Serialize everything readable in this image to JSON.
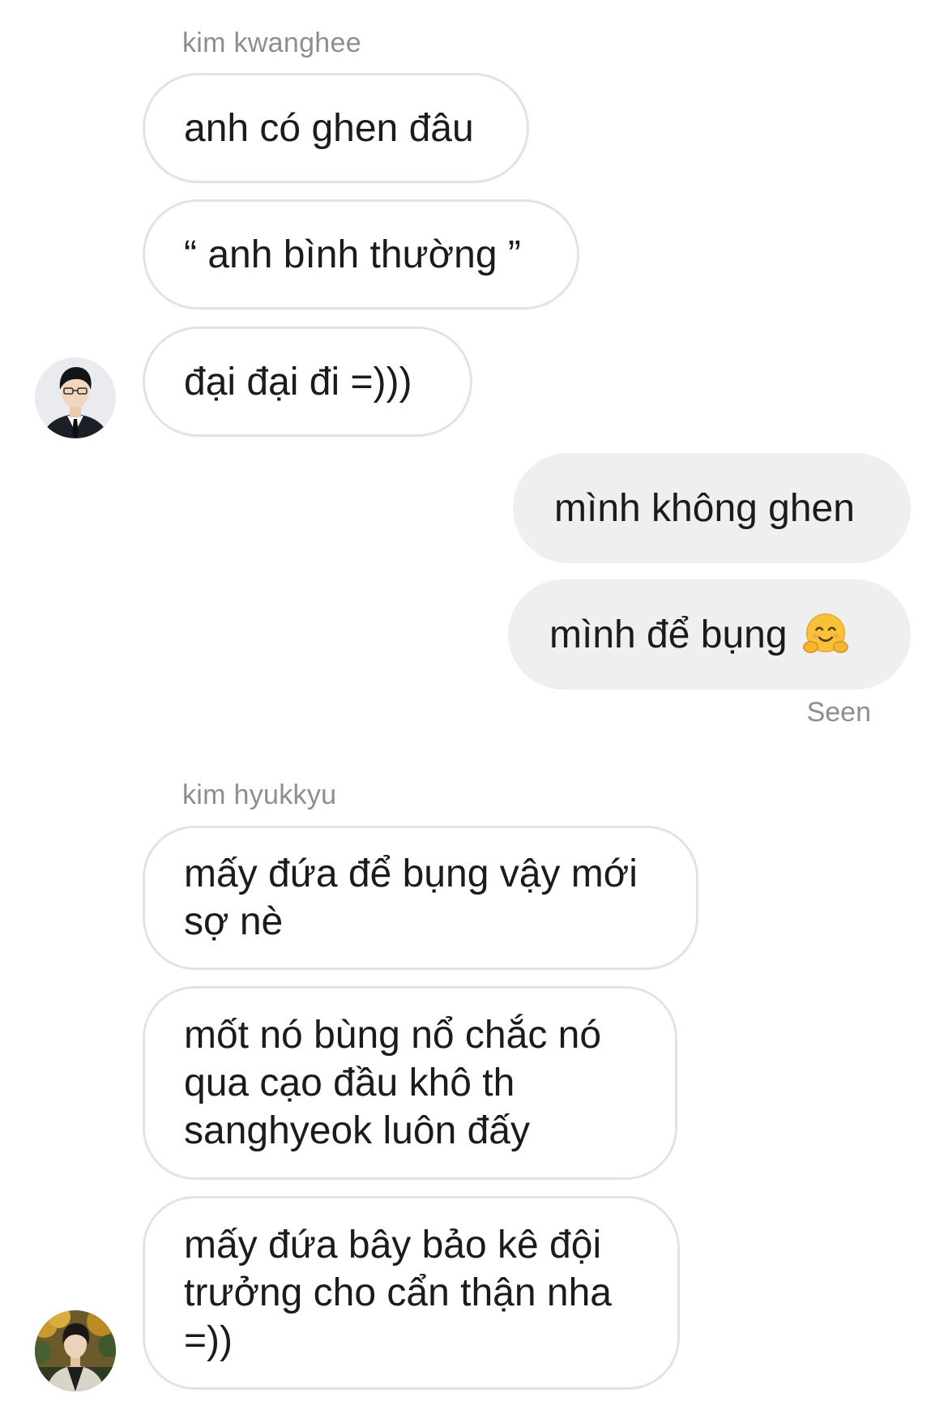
{
  "conversation": {
    "group1": {
      "sender": "kim kwanghee",
      "messages": [
        "anh có ghen đâu",
        "“ anh bình thường ”",
        "đại đại đi =)))"
      ],
      "avatar_icon": "profile-photo-suit-glasses"
    },
    "outgoing": {
      "messages": [
        "mình không ghen",
        "mình để bụng"
      ],
      "emoji_icon": "hugging-face-emoji",
      "status": "Seen"
    },
    "group2": {
      "sender": "kim hyukkyu",
      "messages": [
        "mấy đứa để bụng vậy mới sợ nè",
        "mốt nó bùng nổ chắc nó qua cạo đầu khô th sanghyeok luôn đấy",
        "mấy đứa bây bảo kê đội trưởng cho cẩn thận nha =))"
      ],
      "avatar_icon": "profile-photo-autumn"
    }
  },
  "colors": {
    "incoming_bubble_border": "#e3e3e3",
    "outgoing_bubble_bg": "#efefef",
    "meta_text": "#8e8e8e"
  }
}
